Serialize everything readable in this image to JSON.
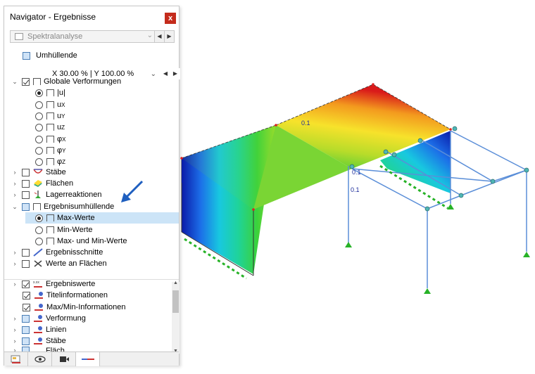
{
  "window": {
    "title": "Navigator - Ergebnisse",
    "close_label": "x"
  },
  "combo": {
    "value": "Spektralanalyse"
  },
  "umhuellende": {
    "label": "Umhüllende"
  },
  "zoom": {
    "value": "X 30.00 % | Y 100.00 %"
  },
  "tree": {
    "globale": "Globale Verformungen",
    "u_abs": "|u|",
    "ux": "u",
    "ux_sub": "X",
    "uy": "u",
    "uy_sub": "Y",
    "uz": "u",
    "uz_sub": "Z",
    "phix": "φ",
    "phix_sub": "X",
    "phiy": "φ",
    "phiy_sub": "Y",
    "phiz": "φ",
    "phiz_sub": "Z",
    "staebe": "Stäbe",
    "flaechen": "Flächen",
    "lager": "Lagerreaktionen",
    "ergebnisumhuellende": "Ergebnisumhüllende",
    "max": "Max-Werte",
    "min": "Min-Werte",
    "maxmin": "Max- und Min-Werte",
    "schnitte": "Ergebnisschnitte",
    "werte_flaechen": "Werte an Flächen"
  },
  "lower": {
    "ergebniswerte": "Ergebniswerte",
    "titel": "Titelinformationen",
    "maxmin": "Max/Min-Informationen",
    "verformung": "Verformung",
    "linien": "Linien",
    "staebe": "Stäbe",
    "flaechen": "Fläch..."
  },
  "model_labels": {
    "v1": "0.1",
    "v2": "0.1",
    "v3": "0.1"
  },
  "colors": {
    "selection": "#cce4f7",
    "accent": "#1f5fbf",
    "close": "#c42b1c"
  }
}
